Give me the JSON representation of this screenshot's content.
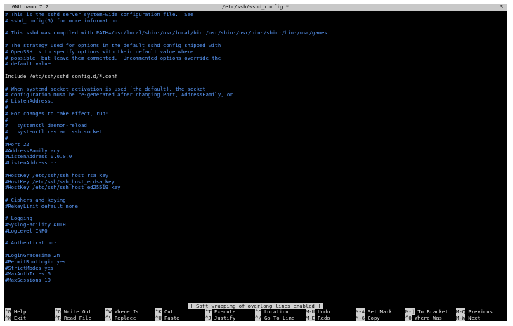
{
  "titlebar": {
    "left": "GNU nano 7.2",
    "center": "/etc/ssh/sshd_config *",
    "right": "S"
  },
  "editor_lines": [
    {
      "text": "# This is the sshd server system-wide configuration file.  See",
      "style": "comment"
    },
    {
      "text": "# sshd_config(5) for more information.",
      "style": "comment"
    },
    {
      "text": "",
      "style": "plain"
    },
    {
      "text": "# This sshd was compiled with PATH=/usr/local/sbin:/usr/local/bin:/usr/sbin:/usr/bin:/sbin:/bin:/usr/games",
      "style": "comment"
    },
    {
      "text": "",
      "style": "plain"
    },
    {
      "text": "# The strategy used for options in the default sshd_config shipped with",
      "style": "comment"
    },
    {
      "text": "# OpenSSH is to specify options with their default value where",
      "style": "comment"
    },
    {
      "text": "# possible, but leave them commented.  Uncommented options override the",
      "style": "comment"
    },
    {
      "text": "# default value.",
      "style": "comment"
    },
    {
      "text": "",
      "style": "plain"
    },
    {
      "text": "Include /etc/ssh/sshd_config.d/*.conf",
      "style": "plain"
    },
    {
      "text": "",
      "style": "plain"
    },
    {
      "text": "# When systemd socket activation is used (the default), the socket",
      "style": "comment"
    },
    {
      "text": "# configuration must be re-generated after changing Port, AddressFamily, or",
      "style": "comment"
    },
    {
      "text": "# ListenAddress.",
      "style": "comment"
    },
    {
      "text": "#",
      "style": "comment"
    },
    {
      "text": "# For changes to take effect, run:",
      "style": "comment"
    },
    {
      "text": "#",
      "style": "comment"
    },
    {
      "text": "#   systemctl daemon-reload",
      "style": "comment"
    },
    {
      "text": "#   systemctl restart ssh.socket",
      "style": "comment"
    },
    {
      "text": "#",
      "style": "comment"
    },
    {
      "text": "#Port 22",
      "style": "comment"
    },
    {
      "text": "#AddressFamily any",
      "style": "comment"
    },
    {
      "text": "#ListenAddress 0.0.0.0",
      "style": "comment"
    },
    {
      "text": "#ListenAddress ::",
      "style": "comment"
    },
    {
      "text": "",
      "style": "plain"
    },
    {
      "text": "#HostKey /etc/ssh/ssh_host_rsa_key",
      "style": "comment"
    },
    {
      "text": "#HostKey /etc/ssh/ssh_host_ecdsa_key",
      "style": "comment"
    },
    {
      "text": "#HostKey /etc/ssh/ssh_host_ed25519_key",
      "style": "comment"
    },
    {
      "text": "",
      "style": "plain"
    },
    {
      "text": "# Ciphers and keying",
      "style": "comment"
    },
    {
      "text": "#RekeyLimit default none",
      "style": "comment"
    },
    {
      "text": "",
      "style": "plain"
    },
    {
      "text": "# Logging",
      "style": "comment"
    },
    {
      "text": "#SyslogFacility AUTH",
      "style": "comment"
    },
    {
      "text": "#LogLevel INFO",
      "style": "comment"
    },
    {
      "text": "",
      "style": "plain"
    },
    {
      "text": "# Authentication:",
      "style": "comment"
    },
    {
      "text": "",
      "style": "plain"
    },
    {
      "text": "#LoginGraceTime 2m",
      "style": "comment"
    },
    {
      "text": "#PermitRootLogin yes",
      "style": "comment"
    },
    {
      "text": "#StrictModes yes",
      "style": "comment"
    },
    {
      "text": "#MaxAuthTries 6",
      "style": "comment"
    },
    {
      "text": "#MaxSessions 10",
      "style": "comment"
    }
  ],
  "status_message": "[ Soft wrapping of overlong lines enabled ]",
  "shortcuts_row1": [
    {
      "key": "^G",
      "label": "Help"
    },
    {
      "key": "^O",
      "label": "Write Out"
    },
    {
      "key": "^W",
      "label": "Where Is"
    },
    {
      "key": "^K",
      "label": "Cut"
    },
    {
      "key": "^T",
      "label": "Execute"
    },
    {
      "key": "^C",
      "label": "Location"
    },
    {
      "key": "M-U",
      "label": "Undo"
    },
    {
      "key": "M-A",
      "label": "Set Mark"
    },
    {
      "key": "M-]",
      "label": "To Bracket"
    },
    {
      "key": "M-Q",
      "label": "Previous"
    }
  ],
  "shortcuts_row2": [
    {
      "key": "^X",
      "label": "Exit"
    },
    {
      "key": "^R",
      "label": "Read File"
    },
    {
      "key": "^\\",
      "label": "Replace"
    },
    {
      "key": "^U",
      "label": "Paste"
    },
    {
      "key": "^J",
      "label": "Justify"
    },
    {
      "key": "^/",
      "label": "Go To Line"
    },
    {
      "key": "M-E",
      "label": "Redo"
    },
    {
      "key": "M-6",
      "label": "Copy"
    },
    {
      "key": "^Q",
      "label": "Where Was"
    },
    {
      "key": "M-W",
      "label": "Next"
    }
  ],
  "colors": {
    "comment": "#5b9cff",
    "plain": "#e8e8e8",
    "background": "#000000",
    "bar": "#c8c8c8"
  }
}
